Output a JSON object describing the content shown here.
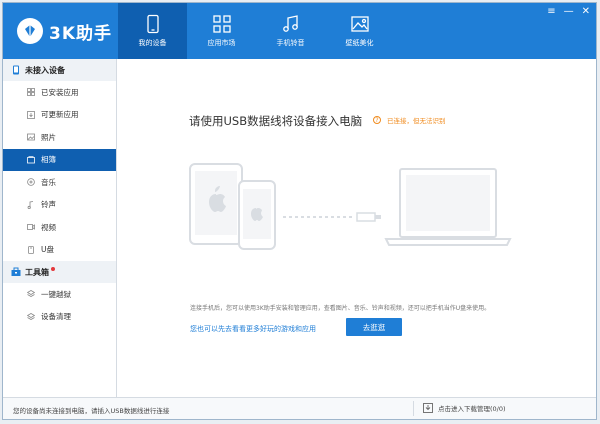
{
  "app": {
    "title": "3K助手"
  },
  "nav": [
    {
      "label": "我的设备",
      "icon": "phone-icon"
    },
    {
      "label": "应用市场",
      "icon": "grid-icon"
    },
    {
      "label": "手机铃音",
      "icon": "music-note-icon"
    },
    {
      "label": "壁纸美化",
      "icon": "image-icon"
    }
  ],
  "sidebar": {
    "device_group": "未接入设备",
    "items": [
      {
        "label": "已安装应用",
        "icon": "grid-icon"
      },
      {
        "label": "可更新应用",
        "icon": "update-icon"
      },
      {
        "label": "照片",
        "icon": "photo-icon"
      },
      {
        "label": "相簿",
        "icon": "album-icon"
      },
      {
        "label": "音乐",
        "icon": "music-icon"
      },
      {
        "label": "铃声",
        "icon": "bell-icon"
      },
      {
        "label": "视频",
        "icon": "video-icon"
      },
      {
        "label": "U盘",
        "icon": "usb-icon"
      }
    ],
    "tools_group": "工具箱",
    "tools": [
      {
        "label": "一键越狱",
        "icon": "layers-icon"
      },
      {
        "label": "设备清理",
        "icon": "clean-icon"
      }
    ]
  },
  "main": {
    "title": "请使用USB数据线将设备接入电脑",
    "hint": "已连接，但无法识别",
    "description": "连接手机后，您可以使用3K助手安装和管理应用，查看图片、音乐、铃声和视频，还可以把手机当作U盘来使用。",
    "link": "您也可以先去看看更多好玩的游戏和应用",
    "button": "去逛逛"
  },
  "status": {
    "left": "您的设备尚未连接到电脑，请插入USB数据线进行连接",
    "right": "点击进入下载管理(0/0)"
  },
  "colors": {
    "brand": "#1f7ed6",
    "active": "#0f5fb0",
    "hint": "#f08b1e"
  }
}
